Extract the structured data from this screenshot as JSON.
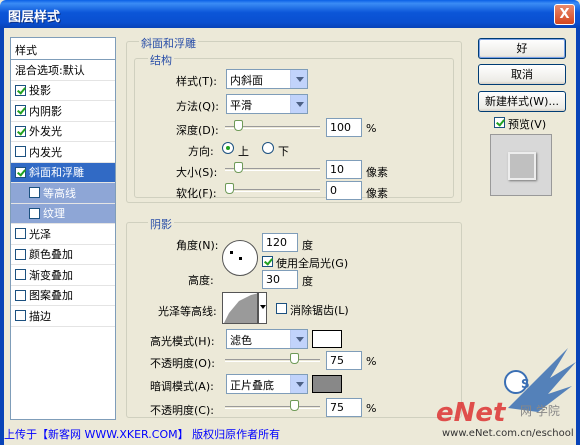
{
  "window": {
    "title": "图层样式",
    "close_glyph": "X"
  },
  "styles_panel": {
    "header": "样式",
    "blend_options": "混合选项:默认",
    "items": [
      {
        "label": "投影",
        "checked": true
      },
      {
        "label": "内阴影",
        "checked": true
      },
      {
        "label": "外发光",
        "checked": true
      },
      {
        "label": "内发光",
        "checked": false
      },
      {
        "label": "斜面和浮雕",
        "checked": true
      },
      {
        "label": "等高线",
        "checked": false
      },
      {
        "label": "纹理",
        "checked": false
      },
      {
        "label": "光泽",
        "checked": false
      },
      {
        "label": "颜色叠加",
        "checked": false
      },
      {
        "label": "渐变叠加",
        "checked": false
      },
      {
        "label": "图案叠加",
        "checked": false
      },
      {
        "label": "描边",
        "checked": false
      }
    ]
  },
  "bevel": {
    "title": "斜面和浮雕",
    "structure_title": "结构",
    "style_label": "样式(T):",
    "style_value": "内斜面",
    "technique_label": "方法(Q):",
    "technique_value": "平滑",
    "depth_label": "深度(D):",
    "depth_value": "100",
    "depth_unit": "%",
    "depth_level": 0.1,
    "direction_label": "方向:",
    "direction_up": "上",
    "direction_down": "下",
    "direction_selected": "上",
    "size_label": "大小(S):",
    "size_value": "10",
    "size_unit": "像素",
    "size_level": 0.1,
    "soften_label": "软化(F):",
    "soften_value": "0",
    "soften_unit": "像素",
    "soften_level": 0
  },
  "shading": {
    "title": "阴影",
    "angle_label": "角度(N):",
    "angle_value": "120",
    "angle_unit": "度",
    "global_light_label": "使用全局光(G)",
    "global_light_checked": true,
    "altitude_label": "高度:",
    "altitude_value": "30",
    "altitude_unit": "度",
    "gloss_label": "光泽等高线:",
    "antialias_label": "消除锯齿(L)",
    "antialias_checked": false,
    "highlight_mode_label": "高光模式(H):",
    "highlight_mode_value": "滤色",
    "highlight_color": "#ffffff",
    "highlight_opacity_label": "不透明度(O):",
    "highlight_opacity_value": "75",
    "highlight_opacity_level": 0.75,
    "shadow_mode_label": "暗调模式(A):",
    "shadow_mode_value": "正片叠底",
    "shadow_color": "#888888",
    "shadow_opacity_label": "不透明度(C):",
    "shadow_opacity_value": "75",
    "shadow_opacity_level": 0.75,
    "percent": "%"
  },
  "buttons": {
    "ok": "好",
    "cancel": "取消",
    "new_style": "新建样式(W)..."
  },
  "preview": {
    "label": "预览(V)",
    "checked": true
  },
  "footer": {
    "text": "上传于【新客网 WWW.XKER.COM】 版权归原作者所有"
  },
  "watermark": {
    "logo_text": "eNet",
    "chinese": "网 学院",
    "url": "www.eNet.com.cn/eschool",
    "seal_text": "S"
  }
}
